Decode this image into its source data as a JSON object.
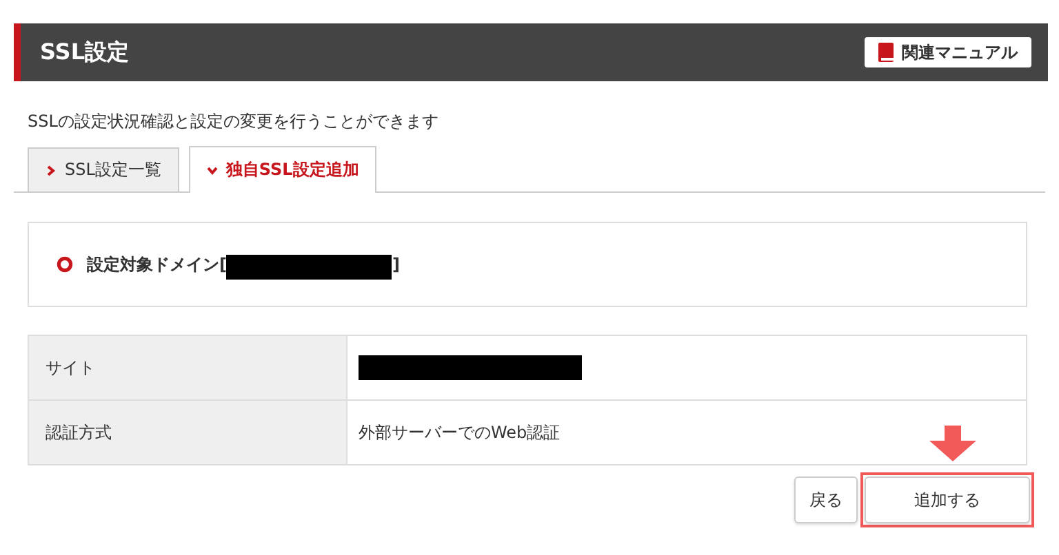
{
  "header": {
    "title": "SSL設定",
    "manual_button": "関連マニュアル"
  },
  "description": "SSLの設定状況確認と設定の変更を行うことができます",
  "tabs": [
    {
      "label": "SSL設定一覧",
      "selected": false
    },
    {
      "label": "独自SSL設定追加",
      "selected": true
    }
  ],
  "domain": {
    "prefix": "設定対象ドメイン[",
    "suffix": "]",
    "redacted": true
  },
  "table": {
    "rows": [
      {
        "label": "サイト",
        "kind": "redacted"
      },
      {
        "label": "認証方式",
        "kind": "text",
        "value": "外部サーバーでのWeb認証"
      }
    ]
  },
  "buttons": [
    {
      "label": "戻る",
      "highlighted": false
    },
    {
      "label": "追加する",
      "highlighted": true
    }
  ]
}
